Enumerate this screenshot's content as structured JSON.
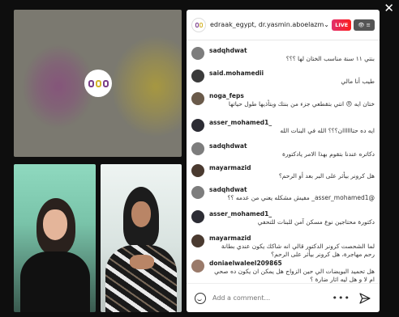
{
  "window": {
    "close_glyph": "✕"
  },
  "header": {
    "title": "edraak_egypt, dr.yasmin.aboelazm",
    "chevron": "⌄",
    "live_label": "LIVE",
    "viewers_label": "👁 ≡",
    "brand_colors": [
      "#7b3f8a",
      "#d4b42a"
    ]
  },
  "comments": [
    {
      "user": "sadqhdwat",
      "text": "بنتي ١١ سنة مناسب الختان لها ؟؟؟",
      "avatar": "#7d7d7d"
    },
    {
      "user": "said.mohamedii",
      "text": "طيب أنا مالي",
      "avatar": "#3b3b3b"
    },
    {
      "user": "noga_feps",
      "text": "ختان ايه 😠 انتي بتقطعي جزء من بنتك وبتأذيها طول حياتها",
      "avatar": "#6a5a4a"
    },
    {
      "user": "asser_mohamed1_",
      "text": "ايه ده حتاااااان؟؟؟ الله في البنات الله",
      "avatar": "#2c2c34"
    },
    {
      "user": "sadqhdwat",
      "text": "دكاتره عندنا بتقوم بهذا الامر يادكتورة",
      "avatar": "#7d7d7d"
    },
    {
      "user": "mayarmazid",
      "text": "هل كرونر بيأثر على البر بعد أو الرحم؟",
      "avatar": "#4a3a30"
    },
    {
      "user": "sadqhdwat",
      "text": "@asser_mohamed1_ مفيش مشكله يعني من عدمه ؟؟",
      "avatar": "#7d7d7d"
    },
    {
      "user": "asser_mohamed1_",
      "text": "دكتورة محتاجين نوع مسكن آمن للبنات للتحفي",
      "avatar": "#2c2c34"
    },
    {
      "user": "mayarmazid",
      "text": "لما الشحصت كرونر الدكتور قالي انه شاكك يكون عندي بطانة رحم مهاجرة، هل كرونر بيأثر على الرحم؟",
      "avatar": "#4a3a30"
    },
    {
      "user": "doniaelwaleel209865",
      "text": "هل تحميد البويضات الي حين الزواج هل يمكن ان يكون ده صحي ام لا و هل ليه اثار ضارة ؟",
      "avatar": "#9a7a6a"
    }
  ],
  "footer": {
    "placeholder": "Add a comment...",
    "more_glyph": "•••"
  }
}
